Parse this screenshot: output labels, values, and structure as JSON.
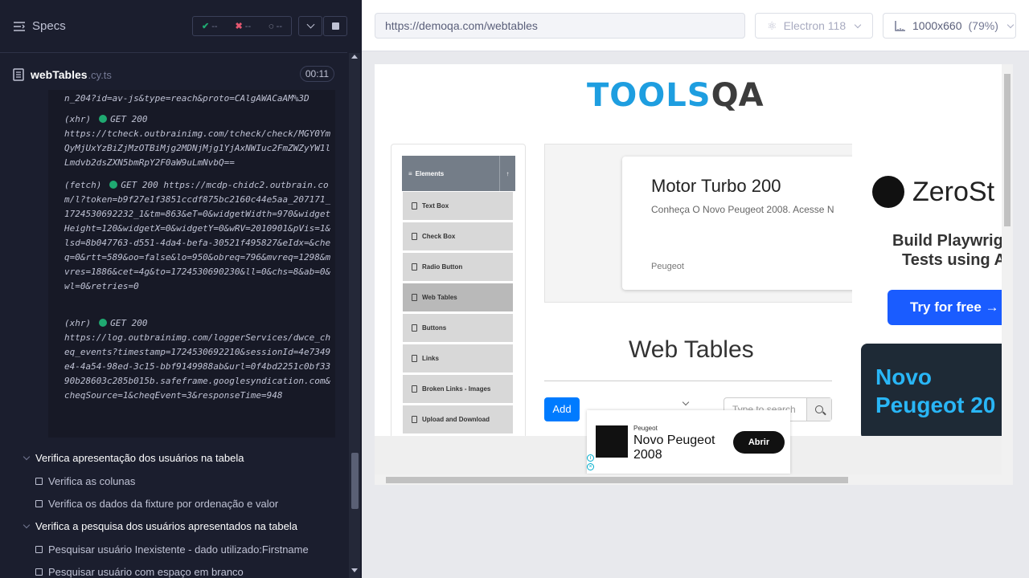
{
  "runner": {
    "specs_label": "Specs",
    "stats": {
      "passed": "--",
      "failed": "--",
      "pending": "--"
    },
    "file": {
      "name": "webTables",
      "ext": ".cy.ts",
      "time": "00:11"
    },
    "log": {
      "top_fragment": "n_204?id=av-js&type=reach&proto=CAlgAWACaAM%3D",
      "entries": [
        {
          "kind": "(xhr)",
          "status": "GET 200",
          "url": "https://tcheck.outbrainimg.com/tcheck/check/MGY0YmQyMjUxYzBiZjMzOTBiMjg2MDNjMjg1YjAxNWIuc2FmZWZyYW1lLmdvb2dsZXN5bmRpY2F0aW9uLmNvbQ=="
        },
        {
          "kind": "(fetch)",
          "status": "GET 200",
          "url": "https://mcdp-chidc2.outbrain.com/l?token=b9f27e1f3851ccdf875bc2160c44e5aa_207171_1724530692232_1&tm=863&eT=0&widgetWidth=970&widgetHeight=120&widgetX=0&widgetY=0&wRV=2010901&pVis=1&lsd=8b047763-d551-4da4-befa-30521f495827&eIdx=&cheq=0&rtt=589&oo=false&lo=950&obreq=796&mvreq=1298&mvres=1886&cet=4g&to=1724530690230&ll=0&chs=8&ab=0&wl=0&retries=0"
        },
        {
          "kind": "(xhr)",
          "status": "GET 200",
          "url": "https://log.outbrainimg.com/loggerServices/dwce_cheq_events?timestamp=1724530692210&sessionId=4e7349e4-4a54-98ed-3c15-bbf9149988ab&url=0f4bd2251c0bf3390b28603c285b015b.safeframe.googlesyndication.com&cheqSource=1&cheqEvent=3&responseTime=948"
        }
      ]
    },
    "suites": [
      {
        "title": "Verifica apresentação dos usuários na tabela",
        "tests": [
          "Verifica as colunas",
          "Verifica os dados da fixture por ordenação e valor"
        ]
      },
      {
        "title": "Verifica a pesquisa dos usuários apresentados na tabela",
        "tests": [
          "Pesquisar usuário Inexistente - dado utilizado:Firstname",
          "Pesquisar usuário com espaço em branco"
        ]
      }
    ]
  },
  "aut_header": {
    "url": "https://demoqa.com/webtables",
    "browser": "Electron 118",
    "viewport": "1000x660",
    "zoom": "(79%)"
  },
  "page": {
    "logo_left": "TOOLS",
    "logo_right": "QA",
    "menu_title": "Elements",
    "menu_items": [
      "Text Box",
      "Check Box",
      "Radio Button",
      "Web Tables",
      "Buttons",
      "Links",
      "Broken Links - Images",
      "Upload and Download"
    ],
    "active_item": "Web Tables",
    "banner": {
      "headline": "Motor Turbo 200",
      "sub": "Conheça O Novo Peugeot 2008. Acesse N",
      "brand": "Peugeot"
    },
    "heading": "Web Tables",
    "add_label": "Add",
    "search_placeholder": "Type to search",
    "side_ad": {
      "brand": "ZeroSt",
      "line1": "Build Playwrig",
      "line2": "Tests using A",
      "cta": "Try for free →",
      "promo1": "Novo",
      "promo2": "Peugeot 20"
    },
    "bottom_ad": {
      "brand": "Peugeot",
      "title1": "Novo Peugeot",
      "title2": "2008",
      "cta": "Abrir"
    }
  }
}
